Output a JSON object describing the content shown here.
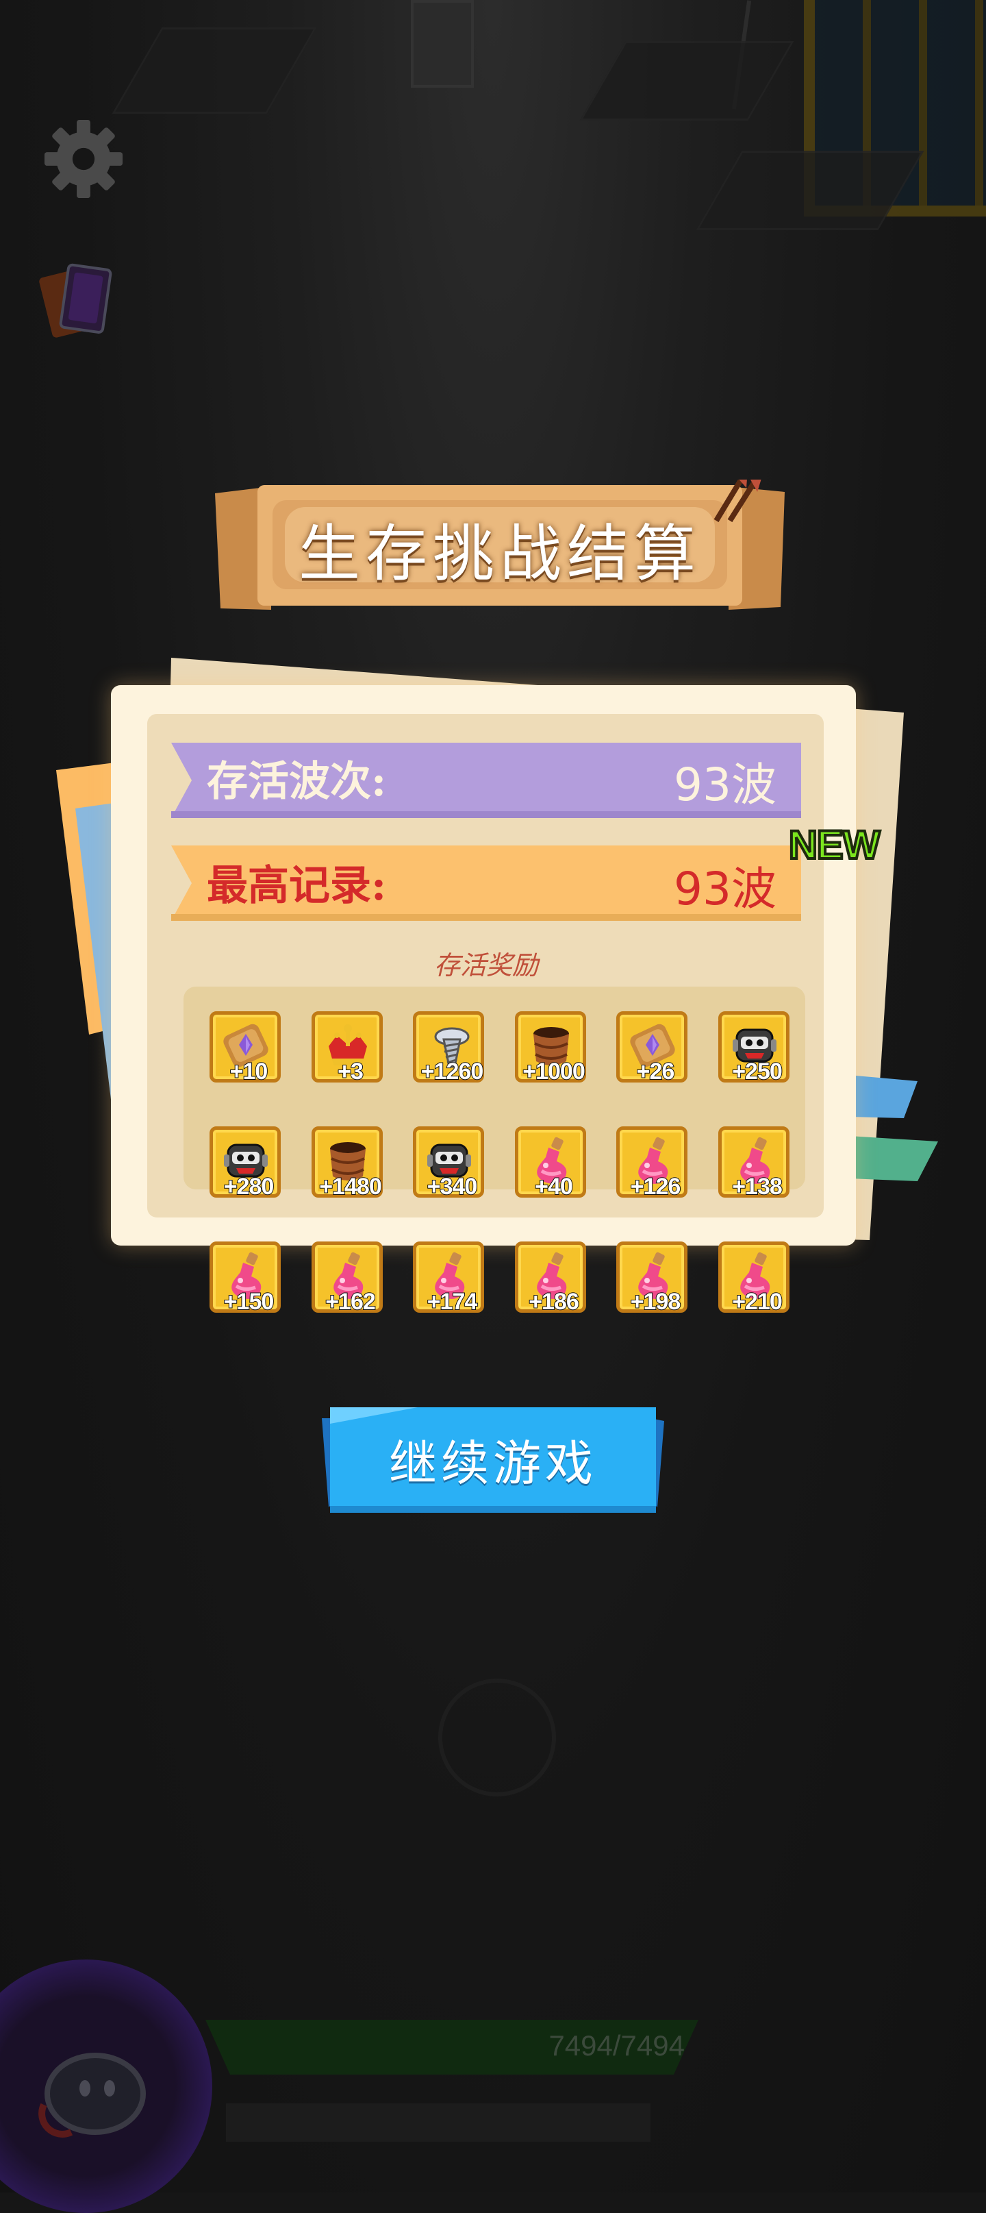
{
  "title": "生存挑战结算",
  "survival": {
    "label": "存活波次:",
    "value": "93波"
  },
  "record": {
    "label": "最高记录:",
    "value": "93波",
    "badge": "NEW"
  },
  "rewards_title": "存活奖励",
  "rewards": [
    {
      "icon": "purple-gem-scroll-icon",
      "count": "+10"
    },
    {
      "icon": "crown-icon",
      "count": "+3"
    },
    {
      "icon": "silver-screw-icon",
      "count": "+1260"
    },
    {
      "icon": "wooden-barrel-icon",
      "count": "+1000"
    },
    {
      "icon": "purple-gem-scroll-icon",
      "count": "+26"
    },
    {
      "icon": "robot-head-icon",
      "count": "+250"
    },
    {
      "icon": "robot-head-icon",
      "count": "+280"
    },
    {
      "icon": "wooden-barrel-icon",
      "count": "+1480"
    },
    {
      "icon": "robot-head-icon",
      "count": "+340"
    },
    {
      "icon": "pink-potion-icon",
      "count": "+40"
    },
    {
      "icon": "pink-potion-icon",
      "count": "+126"
    },
    {
      "icon": "pink-potion-icon",
      "count": "+138"
    },
    {
      "icon": "pink-potion-icon",
      "count": "+150"
    },
    {
      "icon": "pink-potion-icon",
      "count": "+162"
    },
    {
      "icon": "pink-potion-icon",
      "count": "+174"
    },
    {
      "icon": "pink-potion-icon",
      "count": "+186"
    },
    {
      "icon": "pink-potion-icon",
      "count": "+198"
    },
    {
      "icon": "pink-potion-icon",
      "count": "+210"
    }
  ],
  "continue_label": "继续游戏",
  "hud": {
    "hp": "7494/7494"
  },
  "colors": {
    "survival_ribbon": "#b39ddc",
    "record_ribbon": "#fcc16e",
    "button_blue": "#2ab0f5",
    "item_gold": "#f5c22a"
  }
}
